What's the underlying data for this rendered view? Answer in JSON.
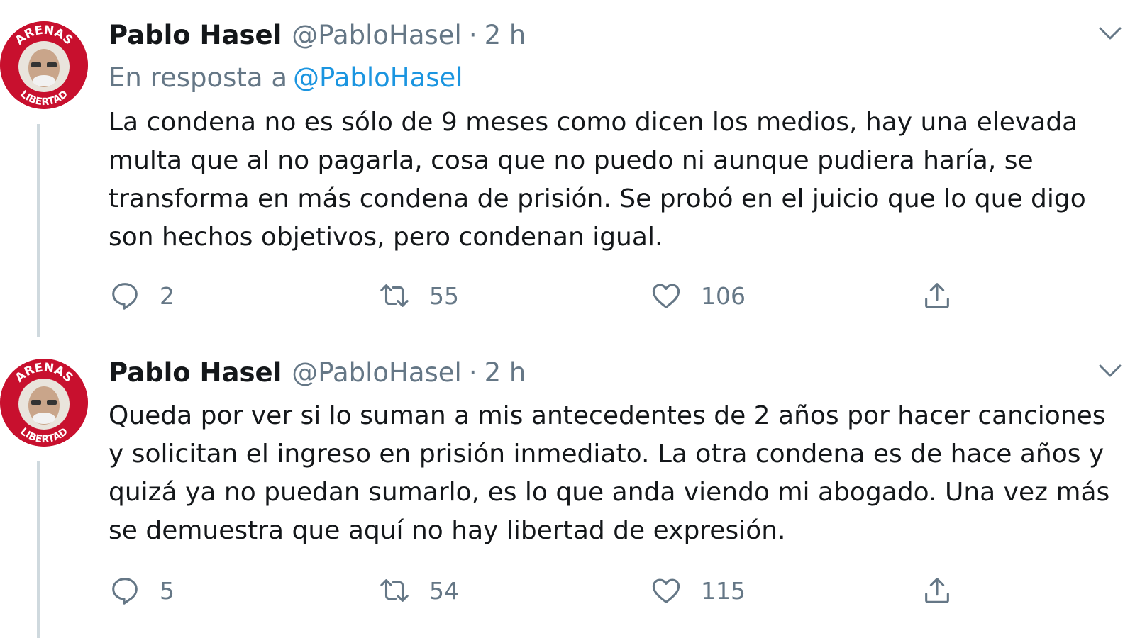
{
  "tweets": [
    {
      "author_name": "Pablo Hasel",
      "handle": "@PabloHasel",
      "separator": "·",
      "time": "2 h",
      "reply_prefix": "En resposta a",
      "reply_mention": "@PabloHasel",
      "lines": [
        "La condena no es sólo de 9 meses como dicen los medios, hay una elevada",
        "multa que al no pagarla, cosa que no puedo ni aunque pudiera haría, se",
        "transforma en más condena de prisión. Se probó en el juicio que lo que digo",
        "son hechos objetivos, pero condenan igual."
      ],
      "replies": "2",
      "retweets": "55",
      "likes": "106"
    },
    {
      "author_name": "Pablo Hasel",
      "handle": "@PabloHasel",
      "separator": "·",
      "time": "2 h",
      "lines": [
        "Queda por ver si lo suman a mis antecedentes de 2 años por hacer canciones",
        "y solicitan el ingreso en prisión inmediato. La otra condena es de hace años y",
        "quizá ya no puedan sumarlo, es lo que anda viendo mi abogado. Una vez más",
        "se demuestra que aquí no hay libertad de expresión."
      ],
      "replies": "5",
      "retweets": "54",
      "likes": "115"
    }
  ],
  "avatar": {
    "text_top": "ARENAS",
    "text_bottom": "LIBERTAD",
    "ring_color": "#c8102e"
  },
  "icons": {
    "reply": "reply-icon",
    "retweet": "retweet-icon",
    "like": "heart-icon",
    "share": "share-icon",
    "more": "chevron-down-icon"
  },
  "colors": {
    "text": "#14171a",
    "secondary": "#657786",
    "mention": "#1b95e0",
    "thread_line": "#cfd9de"
  }
}
